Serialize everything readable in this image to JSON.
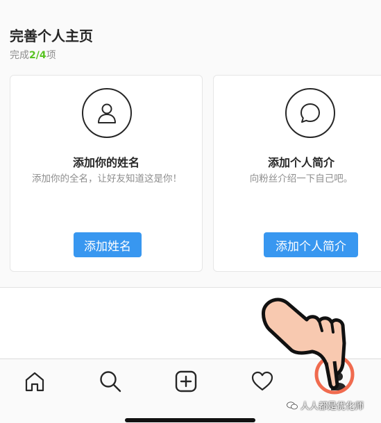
{
  "section": {
    "title": "完善个人主页",
    "progress_prefix": "完成",
    "progress_count": "2/4",
    "progress_suffix": "项"
  },
  "cards": [
    {
      "icon": "person-icon",
      "title": "添加你的姓名",
      "description": "添加你的全名，让好友知道这是你！",
      "button": "添加姓名"
    },
    {
      "icon": "speech-bubble-icon",
      "title": "添加个人简介",
      "description": "向粉丝介绍一下自己吧。",
      "button": "添加个人简介"
    }
  ],
  "tabbar": {
    "items": [
      "home-icon",
      "search-icon",
      "new-post-icon",
      "activity-heart-icon",
      "profile-icon"
    ]
  },
  "colors": {
    "accent": "#3897f0",
    "progress": "#58c322",
    "highlight_ring": "#f06b4f"
  },
  "watermark": "人人都是优化师"
}
